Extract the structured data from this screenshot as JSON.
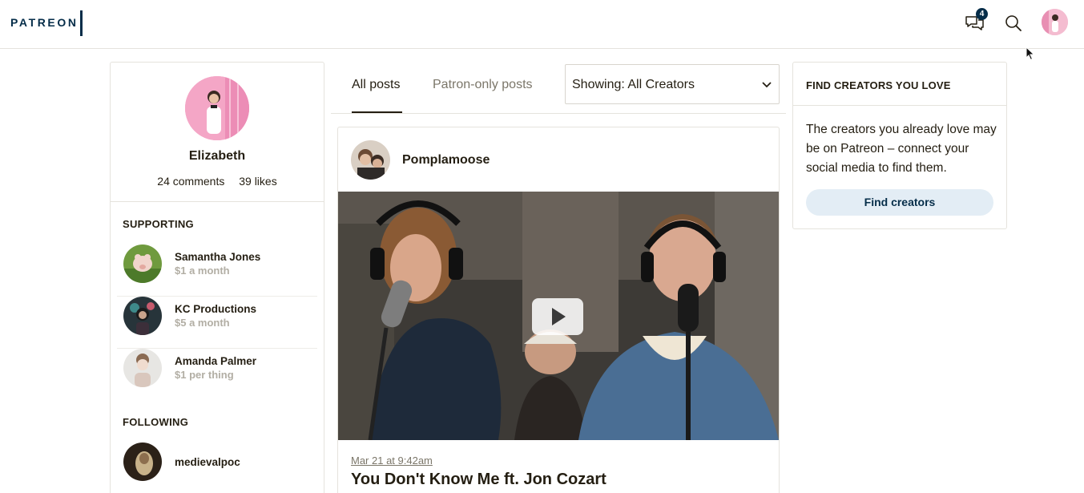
{
  "header": {
    "logo": "PATREON",
    "messages_badge": "4",
    "icons": [
      "messages-icon",
      "search-icon",
      "user-avatar"
    ]
  },
  "profile": {
    "name": "Elizabeth",
    "comments": "24 comments",
    "likes": "39 likes"
  },
  "supporting": {
    "title": "SUPPORTING",
    "items": [
      {
        "name": "Samantha Jones",
        "amount": "$1 a month"
      },
      {
        "name": "KC Productions",
        "amount": "$5 a month"
      },
      {
        "name": "Amanda Palmer",
        "amount": "$1 per thing"
      }
    ]
  },
  "following": {
    "title": "FOLLOWING",
    "items": [
      {
        "name": "medievalpoc"
      }
    ]
  },
  "tabs": {
    "all": "All posts",
    "patron": "Patron-only posts"
  },
  "filter": {
    "label": "Showing: All Creators"
  },
  "post": {
    "creator": "Pomplamoose",
    "date": "Mar 21 at 9:42am",
    "title": "You Don't Know Me ft. Jon Cozart"
  },
  "find_creators": {
    "title": "FIND CREATORS YOU LOVE",
    "body": "The creators you already love may be on Patreon – connect your social media to find them.",
    "button": "Find creators"
  },
  "colors": {
    "brand_navy": "#052d49",
    "text": "#241e12",
    "muted": "#7b7669",
    "button_bg": "#e3edf5"
  }
}
